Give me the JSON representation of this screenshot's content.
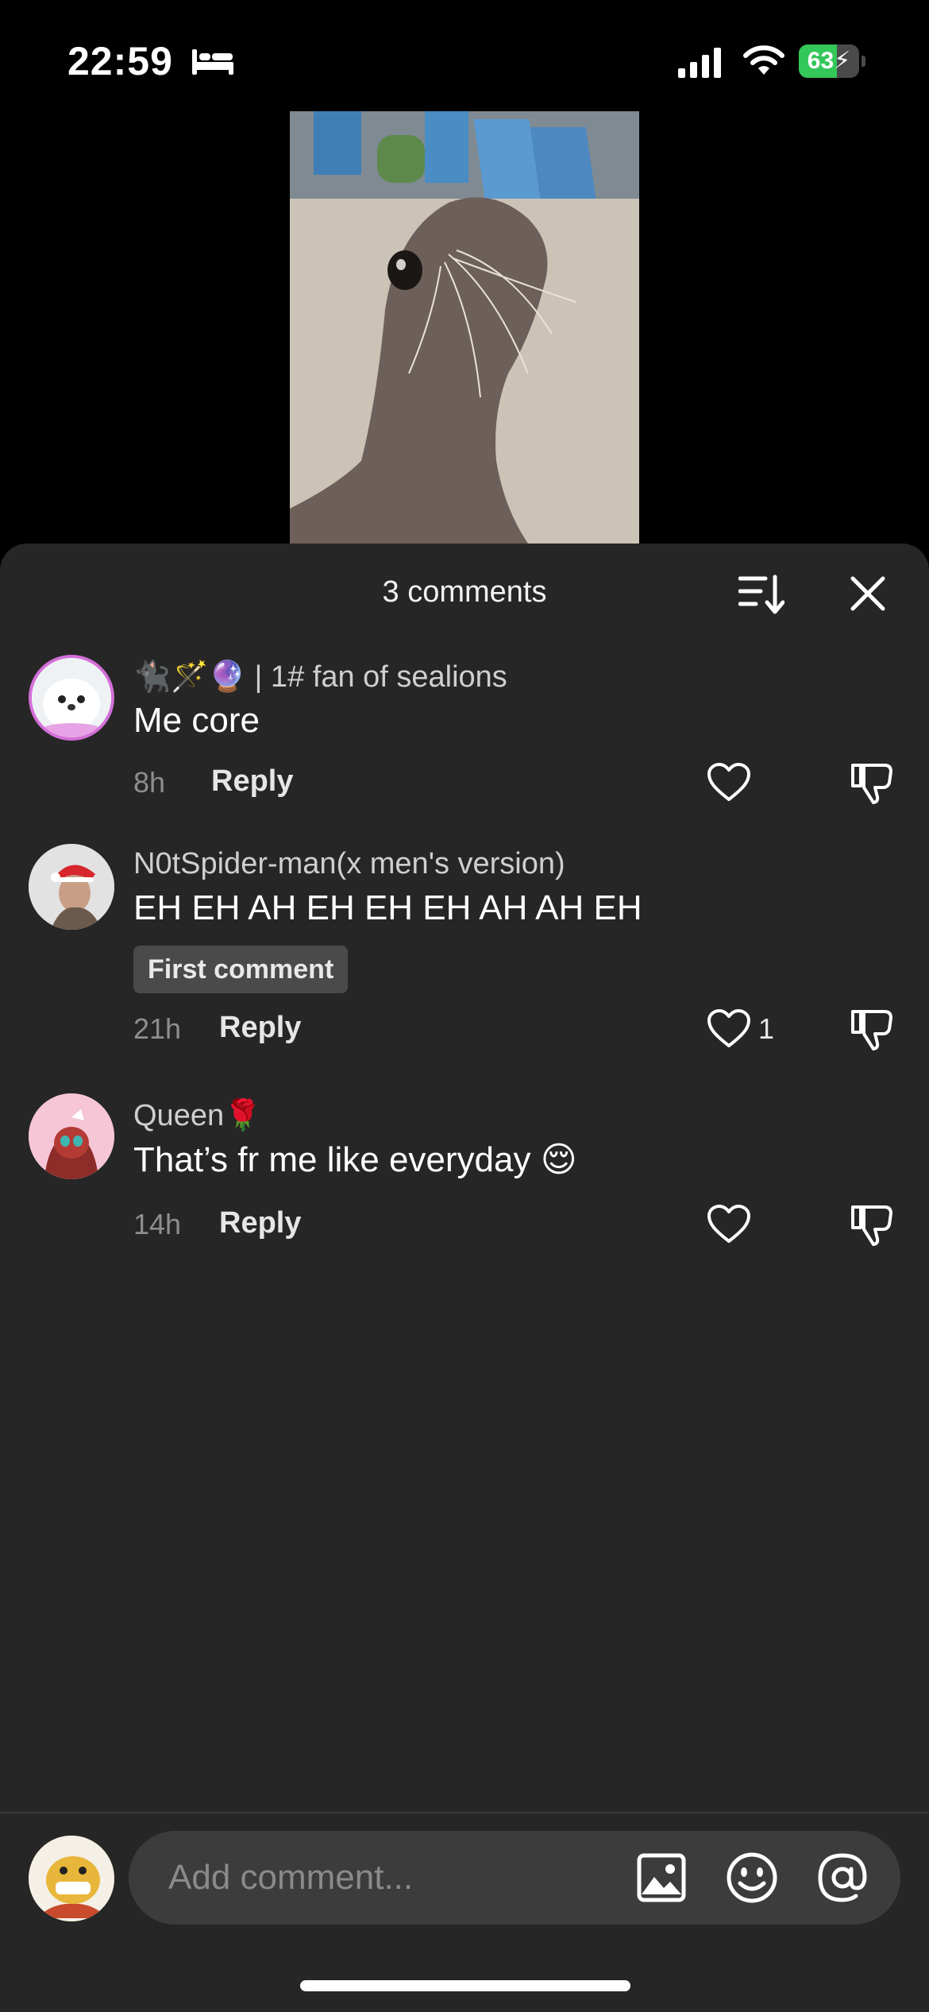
{
  "status_bar": {
    "time": "22:59",
    "battery_level": "63",
    "battery_fraction": 0.63,
    "icons": [
      "bed-icon",
      "signal-icon",
      "wifi-icon",
      "battery-charging-icon"
    ]
  },
  "sheet": {
    "title": "3 comments",
    "sort_icon": "sort-icon",
    "close_icon": "close-icon"
  },
  "comments": [
    {
      "username": "🐈‍⬛🪄🔮 | 1# fan of sealions",
      "text": "Me core",
      "time": "8h",
      "reply_label": "Reply",
      "likes": ""
    },
    {
      "username": "N0tSpider-man(x men's version)",
      "text": "EH EH AH EH EH EH AH AH EH",
      "badge": "First comment",
      "time": "21h",
      "reply_label": "Reply",
      "likes": "1"
    },
    {
      "username": "Queen🌹",
      "text": "That’s fr me like everyday 😌",
      "time": "14h",
      "reply_label": "Reply",
      "likes": ""
    }
  ],
  "input": {
    "placeholder": "Add comment...",
    "icons": [
      "image-icon",
      "emoji-icon",
      "at-icon"
    ]
  },
  "colors": {
    "sheet_bg": "#262626",
    "input_bg": "#3c3c3c",
    "battery_green": "#34c759"
  }
}
